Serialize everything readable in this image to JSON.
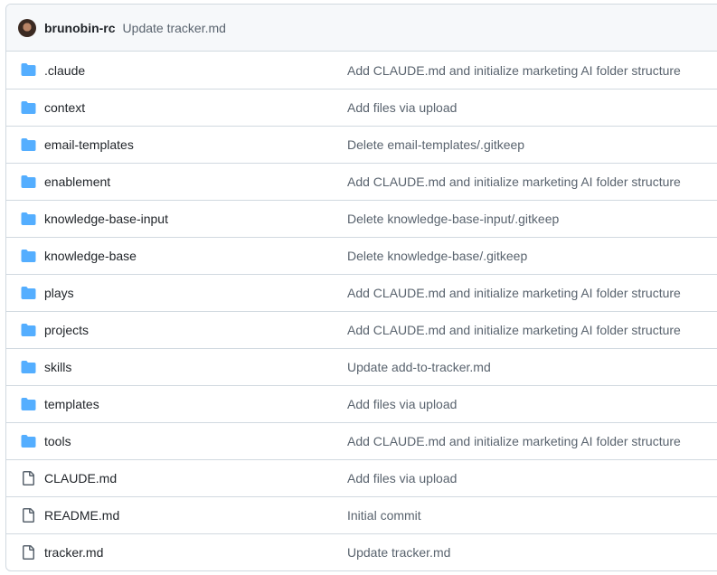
{
  "header": {
    "author": "brunobin-rc",
    "message": "Update tracker.md"
  },
  "colors": {
    "folder": "#54aeff",
    "file": "#59636e"
  },
  "rows": [
    {
      "type": "folder",
      "name": ".claude",
      "message": "Add CLAUDE.md and initialize marketing AI folder structure"
    },
    {
      "type": "folder",
      "name": "context",
      "message": "Add files via upload"
    },
    {
      "type": "folder",
      "name": "email-templates",
      "message": "Delete email-templates/.gitkeep"
    },
    {
      "type": "folder",
      "name": "enablement",
      "message": "Add CLAUDE.md and initialize marketing AI folder structure"
    },
    {
      "type": "folder",
      "name": "knowledge-base-input",
      "message": "Delete knowledge-base-input/.gitkeep"
    },
    {
      "type": "folder",
      "name": "knowledge-base",
      "message": "Delete knowledge-base/.gitkeep"
    },
    {
      "type": "folder",
      "name": "plays",
      "message": "Add CLAUDE.md and initialize marketing AI folder structure"
    },
    {
      "type": "folder",
      "name": "projects",
      "message": "Add CLAUDE.md and initialize marketing AI folder structure"
    },
    {
      "type": "folder",
      "name": "skills",
      "message": "Update add-to-tracker.md"
    },
    {
      "type": "folder",
      "name": "templates",
      "message": "Add files via upload"
    },
    {
      "type": "folder",
      "name": "tools",
      "message": "Add CLAUDE.md and initialize marketing AI folder structure"
    },
    {
      "type": "file",
      "name": "CLAUDE.md",
      "message": "Add files via upload"
    },
    {
      "type": "file",
      "name": "README.md",
      "message": "Initial commit"
    },
    {
      "type": "file",
      "name": "tracker.md",
      "message": "Update tracker.md"
    }
  ]
}
